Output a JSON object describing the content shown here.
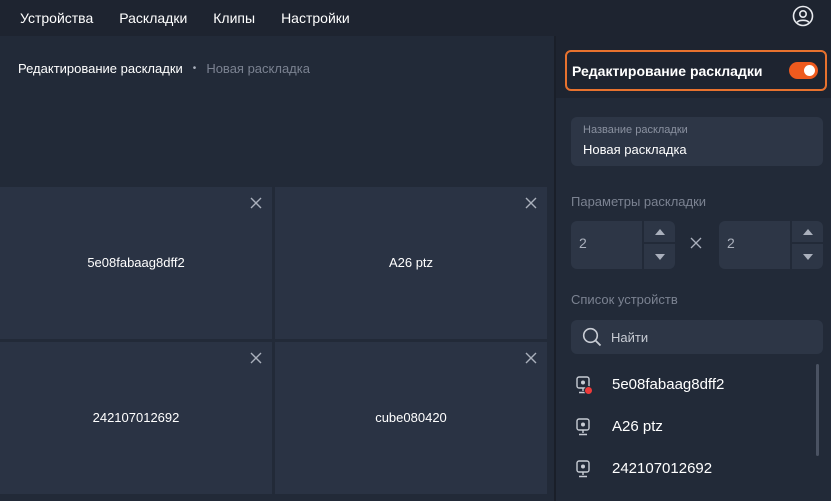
{
  "nav": {
    "items": [
      {
        "label": "Устройства"
      },
      {
        "label": "Раскладки"
      },
      {
        "label": "Клипы"
      },
      {
        "label": "Настройки"
      }
    ],
    "user_icon": "user-circle-icon"
  },
  "breadcrumb": {
    "current": "Редактирование раскладки",
    "separator": "•",
    "sub": "Новая раскладка"
  },
  "layout_grid": {
    "cells": [
      {
        "label": "5e08fabaag8dff2"
      },
      {
        "label": "A26 ptz"
      },
      {
        "label": "242107012692"
      },
      {
        "label": "cube080420"
      }
    ],
    "close_icon": "close-icon"
  },
  "panel": {
    "edit_toggle": {
      "label": "Редактирование раскладки",
      "enabled": true,
      "accent_color": "#e8722e"
    },
    "name_field": {
      "label": "Название раскладки",
      "value": "Новая раскладка"
    },
    "params": {
      "title": "Параметры раскладки",
      "rows": "2",
      "cols": "2",
      "separator_icon": "times-icon"
    },
    "devices": {
      "title": "Список устройств",
      "search_placeholder": "Найти",
      "items": [
        {
          "label": "5e08fabaag8dff2",
          "icon": "camera-icon",
          "alert": true
        },
        {
          "label": "A26 ptz",
          "icon": "camera-icon",
          "alert": false
        },
        {
          "label": "242107012692",
          "icon": "camera-icon",
          "alert": false
        }
      ]
    }
  }
}
